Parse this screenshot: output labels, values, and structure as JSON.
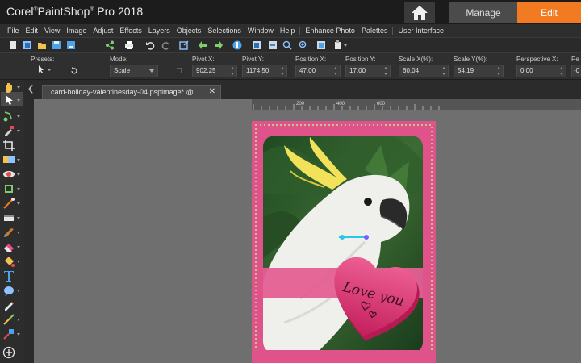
{
  "app": {
    "title_main": "Corel",
    "title_reg": "®",
    "title_rest": "PaintShop",
    "title_reg2": "®",
    "title_tail": " Pro 2018"
  },
  "workspace_tabs": {
    "manage": "Manage",
    "edit": "Edit"
  },
  "colors": {
    "accent": "#f27a21",
    "card_pink": "#e0528a",
    "heart": "#d82f6d"
  },
  "menu": {
    "items": [
      "File",
      "Edit",
      "View",
      "Image",
      "Adjust",
      "Effects",
      "Layers",
      "Objects",
      "Selections",
      "Window",
      "Help"
    ],
    "extra": [
      "Enhance Photo",
      "Palettes"
    ],
    "ui": "User Interface"
  },
  "toolbar_icons": [
    "new-icon",
    "new-from-template-icon",
    "open-icon",
    "save-icon",
    "save-as-icon",
    "share-icon",
    "print-icon",
    "undo-icon",
    "redo-icon",
    "crop-icon",
    "undo-history-icon",
    "redo-history-icon",
    "info-icon",
    "fit-window-icon",
    "zoom-out-icon",
    "zoom-in-icon",
    "actual-size-icon",
    "copy-icon"
  ],
  "options": {
    "presets_label": "Presets:",
    "mode_label": "Mode:",
    "mode_value": "Scale",
    "pivot_x_label": "Pivot X:",
    "pivot_x": "902.25",
    "pivot_y_label": "Pivot Y:",
    "pivot_y": "1174.50",
    "pos_x_label": "Position X:",
    "pos_x": "47.00",
    "pos_y_label": "Position Y:",
    "pos_y": "17.00",
    "scale_x_label": "Scale X(%):",
    "scale_x": "60.04",
    "scale_y_label": "Scale Y(%):",
    "scale_y": "54.19",
    "perspective_x_label": "Perspective X:",
    "perspective_x": "0.00",
    "perspective_y_label": "Pe",
    "perspective_y": "-0"
  },
  "tools": [
    "pan-icon",
    "pick-icon",
    "selection-icon",
    "dropper-icon",
    "crop-icon",
    "straighten-icon",
    "red-eye-icon",
    "makeover-icon",
    "clone-brush-icon",
    "scratch-remover-icon",
    "paint-brush-icon",
    "eraser-icon",
    "fill-icon",
    "text-icon",
    "shape-icon",
    "pen-icon",
    "retouch-icon",
    "picture-tube-icon",
    "add-icon"
  ],
  "document": {
    "tab_label": "card-holiday-valentinesday-04.pspimage*",
    "tab_suffix": "@...",
    "close": "✕"
  },
  "ruler": {
    "marks": [
      "200",
      "400",
      "600"
    ]
  },
  "card": {
    "heart_text_line1": "Love you"
  }
}
